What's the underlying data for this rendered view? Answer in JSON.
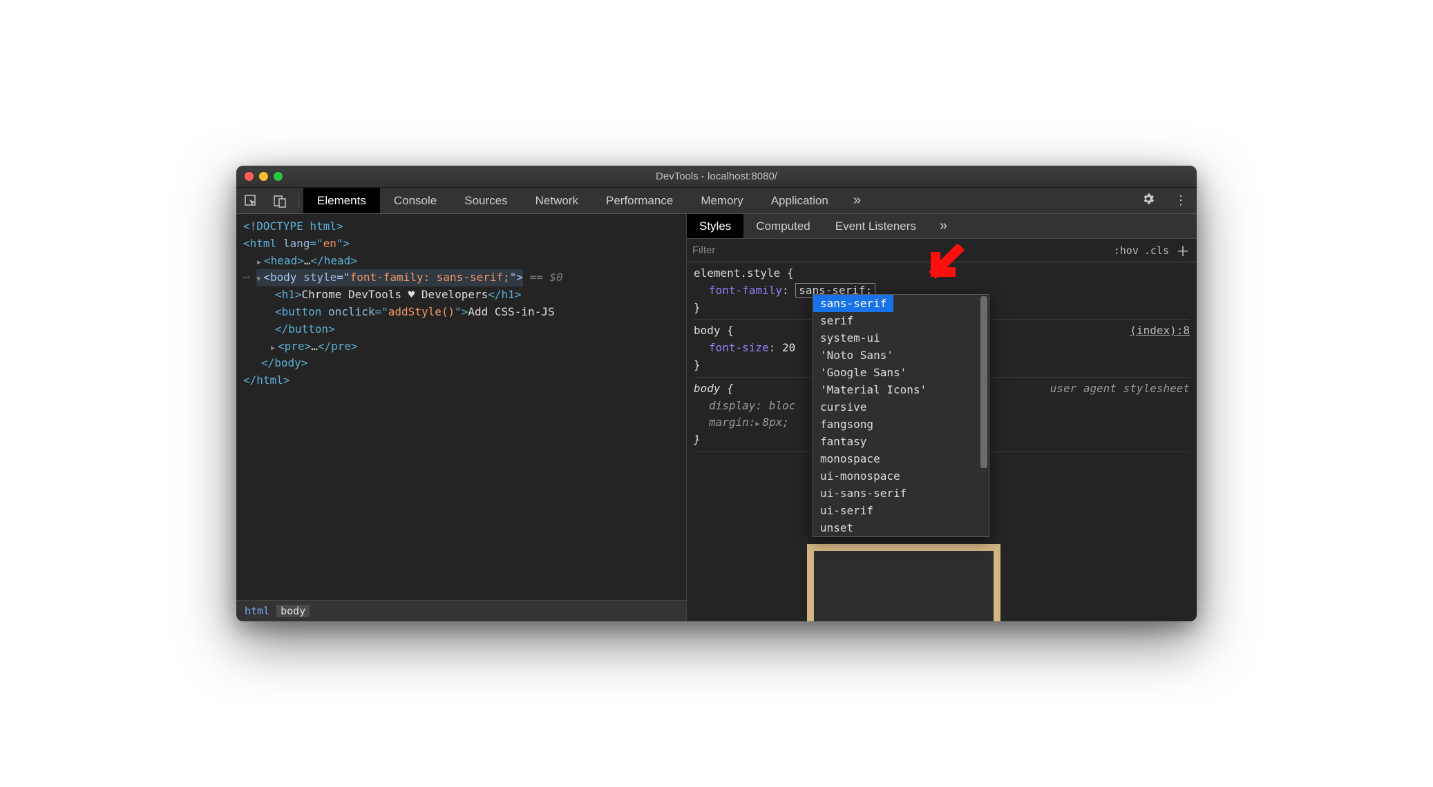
{
  "window": {
    "title": "DevTools - localhost:8080/"
  },
  "main_tabs": [
    "Elements",
    "Console",
    "Sources",
    "Network",
    "Performance",
    "Memory",
    "Application"
  ],
  "main_tab_active": 0,
  "dom": {
    "doctype": "<!DOCTYPE html>",
    "html_open": {
      "tag": "html",
      "attr": "lang",
      "val": "en"
    },
    "head": {
      "open": "<head>",
      "ell": "…",
      "close": "</head>"
    },
    "body": {
      "tag": "body",
      "attr": "style",
      "val": "font-family: sans-serif;",
      "eq": " == $0"
    },
    "h1": {
      "open": "<h1>",
      "text": "Chrome DevTools ♥ Developers",
      "close": "</h1>"
    },
    "button": {
      "open_tag": "button",
      "attr": "onclick",
      "val": "addStyle()",
      "text": "Add CSS-in-JS",
      "close": "</button>"
    },
    "pre": {
      "open": "<pre>",
      "ell": "…",
      "close": "</pre>"
    },
    "body_close": "</body>",
    "html_close": "</html>"
  },
  "breadcrumb": [
    "html",
    "body"
  ],
  "sub_tabs": [
    "Styles",
    "Computed",
    "Event Listeners"
  ],
  "sub_tab_active": 0,
  "filter_placeholder": "Filter",
  "hov": ":hov",
  "cls": ".cls",
  "rules": {
    "element_style": {
      "selector": "element.style",
      "prop": "font-family",
      "val": "sans-serif;"
    },
    "body_index": {
      "selector": "body",
      "prop": "font-size",
      "val": "20",
      "src": "(index):8"
    },
    "body_ua": {
      "selector": "body",
      "props": [
        [
          "display",
          "bloc"
        ],
        [
          "margin",
          "8px;"
        ]
      ],
      "src": "user agent stylesheet"
    }
  },
  "autocomplete": [
    "sans-serif",
    "serif",
    "system-ui",
    "'Noto Sans'",
    "'Google Sans'",
    "'Material Icons'",
    "cursive",
    "fangsong",
    "fantasy",
    "monospace",
    "ui-monospace",
    "ui-sans-serif",
    "ui-serif",
    "unset"
  ],
  "autocomplete_selected": 0
}
